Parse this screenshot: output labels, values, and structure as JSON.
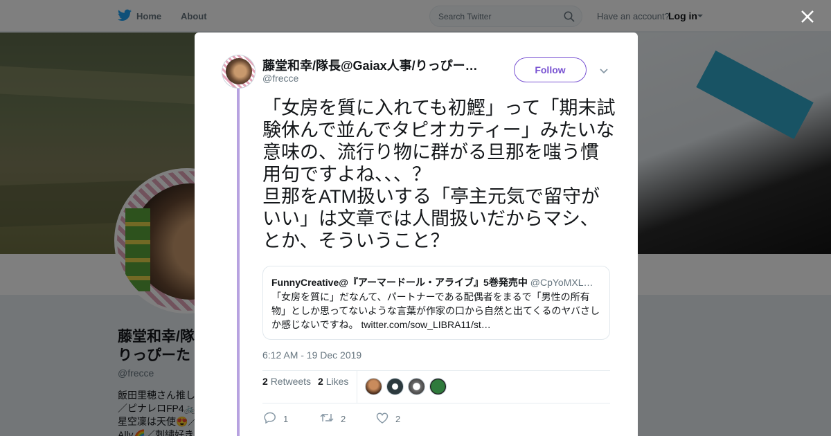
{
  "topbar": {
    "home_label": "Home",
    "about_label": "About",
    "search_placeholder": "Search Twitter",
    "account_question": "Have an account?",
    "login_label": "Log in"
  },
  "profile": {
    "name_line1": "藤堂和幸/隊",
    "name_line2": "りっぴーた",
    "handle": "@frecce",
    "bio": [
      "飯田里穂さん推し",
      "／ピナレロFP4🚲",
      "星空凜は天使😍／",
      "Ally🌈／刺繍好き"
    ]
  },
  "tweet": {
    "author_name": "藤堂和幸/隊長@Gaiax人事/りっぴー…",
    "author_handle": "@frecce",
    "follow_label": "Follow",
    "text": "「女房を質に入れても初鰹」って「期末試験休んで並んでタピオカティー」みたいな意味の、流行り物に群がる旦那を嗤う慣用句ですよね、、、？\n旦那をATM扱いする「亭主元気で留守がいい」は文章では人間扱いだからマシ、とか、そういうこと？",
    "quote": {
      "name": "FunnyCreative@『アーマードール・アライブ』5巻発売中",
      "handle": "@CpYoMXL…",
      "text": "「女房を質に」だなんて、パートナーである配偶者をまるで「男性の所有物」としか思ってないような言葉が作家の口から自然と出てくるのヤバさしか感じないですね。 twitter.com/sow_LIBRA11/st…"
    },
    "timestamp": "6:12 AM - 19 Dec 2019",
    "retweets_count": "2",
    "retweets_label": "Retweets",
    "likes_count": "2",
    "likes_label": "Likes",
    "actions": {
      "reply_count": "1",
      "retweet_count": "2",
      "like_count": "2"
    }
  },
  "colors": {
    "accent": "#7953d2",
    "thread": "#b7a2e0",
    "twitter_blue": "#1da1f2"
  }
}
